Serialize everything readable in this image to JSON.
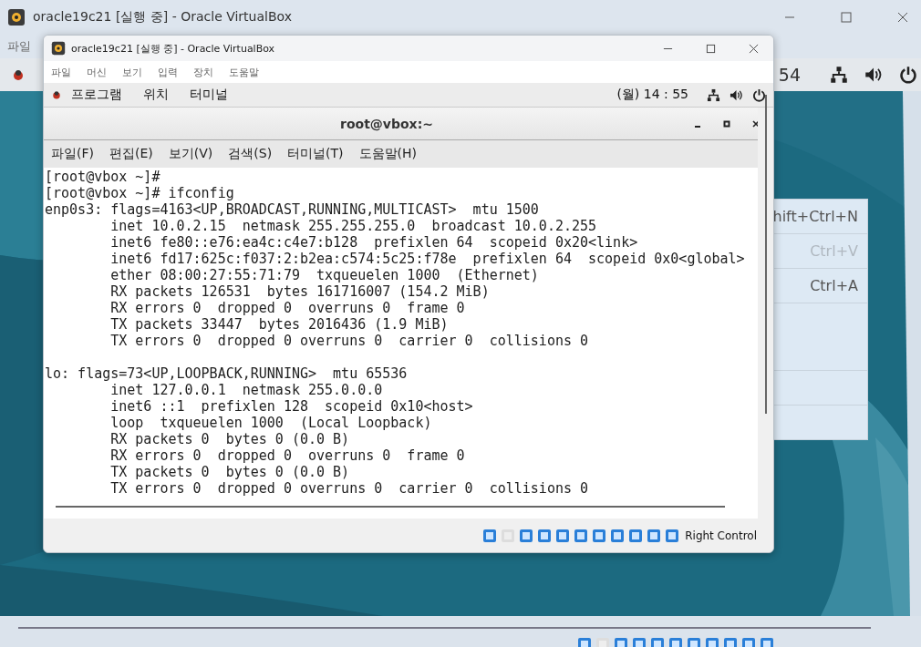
{
  "outer_window": {
    "title": "oracle19c21 [실행 중] - Oracle VirtualBox",
    "menu": [
      "파일"
    ],
    "guest_panel": {
      "clock_fragment": "54"
    },
    "context_menu": {
      "items": [
        {
          "kind": "shortcut",
          "shortcut": "hift+Ctrl+N",
          "disabled": false
        },
        {
          "kind": "shortcut",
          "shortcut": "Ctrl+V",
          "disabled": true
        },
        {
          "kind": "shortcut",
          "shortcut": "Ctrl+A",
          "disabled": false
        },
        {
          "kind": "gap"
        },
        {
          "kind": "empty"
        },
        {
          "kind": "empty"
        }
      ]
    }
  },
  "inner_window": {
    "title": "oracle19c21 [실행 중] - Oracle VirtualBox",
    "menu": [
      "파일",
      "머신",
      "보기",
      "입력",
      "장치",
      "도움말"
    ],
    "guest_panel": {
      "menu": [
        "프로그램",
        "위치",
        "터미널"
      ],
      "clock": "(월) 14 : 55"
    },
    "terminal": {
      "title": "root@vbox:~",
      "menu": [
        "파일(F)",
        "편집(E)",
        "보기(V)",
        "검색(S)",
        "터미널(T)",
        "도움말(H)"
      ],
      "lines": [
        "[root@vbox ~]#",
        "[root@vbox ~]# ifconfig"
      ],
      "blocks": [
        [
          "enp0s3: flags=4163<UP,BROADCAST,RUNNING,MULTICAST>  mtu 1500",
          "        inet 10.0.2.15  netmask 255.255.255.0  broadcast 10.0.2.255",
          "        inet6 fe80::e76:ea4c:c4e7:b128  prefixlen 64  scopeid 0x20<link>",
          "        inet6 fd17:625c:f037:2:b2ea:c574:5c25:f78e  prefixlen 64  scopeid 0x0<global>",
          "        ether 08:00:27:55:71:79  txqueuelen 1000  (Ethernet)",
          "        RX packets 126531  bytes 161716007 (154.2 MiB)",
          "        RX errors 0  dropped 0  overruns 0  frame 0",
          "        TX packets 33447  bytes 2016436 (1.9 MiB)",
          "        TX errors 0  dropped 0 overruns 0  carrier 0  collisions 0"
        ],
        [
          "lo: flags=73<UP,LOOPBACK,RUNNING>  mtu 65536",
          "        inet 127.0.0.1  netmask 255.0.0.0",
          "        inet6 ::1  prefixlen 128  scopeid 0x10<host>",
          "        loop  txqueuelen 1000  (Local Loopback)",
          "        RX packets 0  bytes 0 (0.0 B)",
          "        RX errors 0  dropped 0  overruns 0  frame 0",
          "        TX packets 0  bytes 0 (0.0 B)",
          "        TX errors 0  dropped 0 overruns 0  carrier 0  collisions 0"
        ]
      ]
    },
    "status_bar": {
      "text": "Right Control"
    }
  }
}
